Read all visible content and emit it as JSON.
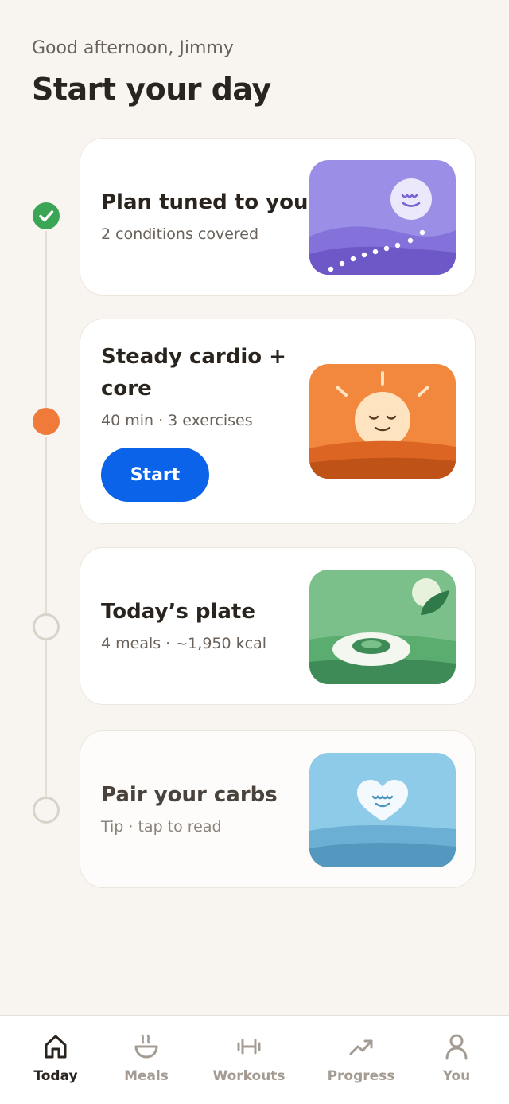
{
  "header": {
    "greeting": "Good afternoon, Jimmy",
    "title": "Start your day"
  },
  "steps": [
    {
      "title": "Plan tuned to you",
      "subtitle": "2 conditions covered",
      "status": "done"
    },
    {
      "title": "Steady cardio +\ncore",
      "subtitle": "40 min · 3 exercises",
      "status": "active",
      "button_label": "Start"
    },
    {
      "title": "Today’s plate",
      "subtitle": "4 meals · ~1,950 kcal",
      "status": "pending"
    },
    {
      "title": "Pair your carbs",
      "subtitle": "Tip · tap to read",
      "status": "pending"
    }
  ],
  "tabbar": {
    "tabs": [
      {
        "label": "Today",
        "icon": "home-icon",
        "active": true
      },
      {
        "label": "Meals",
        "icon": "bowl-icon",
        "active": false
      },
      {
        "label": "Workouts",
        "icon": "dumbbell-icon",
        "active": false
      },
      {
        "label": "Progress",
        "icon": "trend-up-icon",
        "active": false
      },
      {
        "label": "You",
        "icon": "person-icon",
        "active": false
      }
    ]
  },
  "colors": {
    "background": "#f8f5f0",
    "accent_blue": "#0a63e8",
    "done_green": "#3aa655",
    "active_orange": "#f07a3a"
  }
}
